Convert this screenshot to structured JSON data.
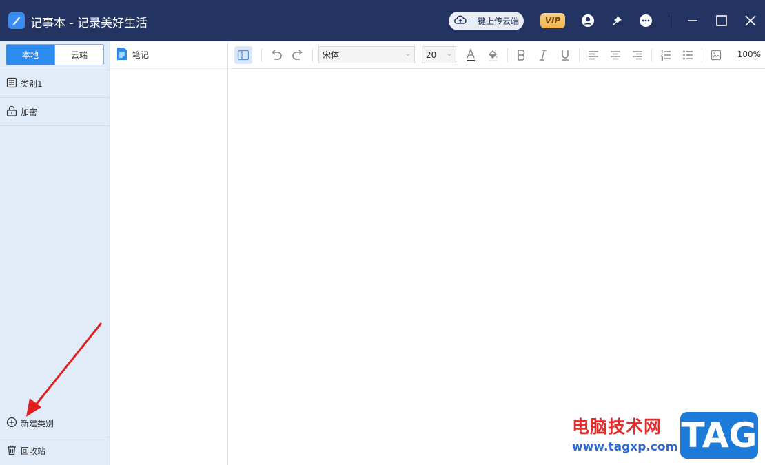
{
  "window": {
    "title": "记事本 - 记录美好生活",
    "upload_label": "一键上传云端",
    "vip_label": "VIP",
    "accent": "#2d8cf0",
    "titlebar_color": "#243462"
  },
  "sidebar": {
    "tabs": [
      {
        "label": "本地",
        "active": true
      },
      {
        "label": "云端",
        "active": false
      }
    ],
    "categories": [
      {
        "label": "类别1",
        "icon": "list-icon"
      },
      {
        "label": "加密",
        "icon": "lock-icon"
      }
    ],
    "new_category_label": "新建类别",
    "trash_label": "回收站"
  },
  "notes": {
    "header_label": "笔记"
  },
  "toolbar": {
    "font_family": "宋体",
    "font_size": "20",
    "zoom": "100%"
  },
  "watermark": {
    "site_name": "电脑技术网",
    "url": "www.tagxp.com",
    "logo_text": "TAG"
  }
}
